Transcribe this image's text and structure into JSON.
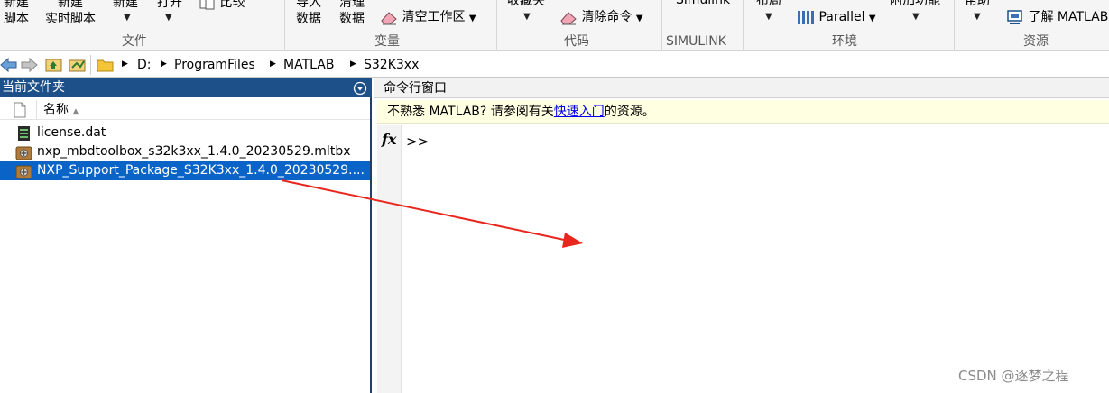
{
  "ribbon": {
    "file_group": {
      "label": "文件",
      "new_script": [
        "新建",
        "脚本"
      ],
      "new_live_script": [
        "新建",
        "实时脚本"
      ],
      "new": "新建",
      "open": "打开",
      "compare": "比较"
    },
    "variable_group": {
      "label": "变量",
      "import_data": [
        "导入",
        "数据"
      ],
      "clean_data": [
        "清理",
        "数据"
      ],
      "clear_workspace": "清空工作区"
    },
    "code_group": {
      "label": "代码",
      "favorites": "收藏夹",
      "clear_commands": "清除命令"
    },
    "simulink_group": {
      "label": "SIMULINK",
      "simulink": "Simulink"
    },
    "environment_group": {
      "label": "环境",
      "layout": "布局",
      "parallel": "Parallel",
      "addons": "附加功能"
    },
    "resources_group": {
      "label": "资源",
      "help": "帮助",
      "learn_matlab": "了解 MATLAB"
    }
  },
  "address_bar": {
    "path": [
      "D:",
      "ProgramFiles",
      "MATLAB",
      "S32K3xx"
    ]
  },
  "folder_pane": {
    "title": "当前文件夹",
    "column_name": "名称",
    "files": [
      {
        "name": "license.dat",
        "icon": "dat-file-icon",
        "selected": false
      },
      {
        "name": "nxp_mbdtoolbox_s32k3xx_1.4.0_20230529.mltbx",
        "icon": "toolbox-file-icon",
        "selected": false
      },
      {
        "name": "NXP_Support_Package_S32K3xx_1.4.0_20230529....",
        "icon": "toolbox-file-icon",
        "selected": true
      }
    ]
  },
  "command_window": {
    "title": "命令行窗口",
    "notice_prefix": "不熟悉 MATLAB? 请参阅有关",
    "notice_link": "快速入门",
    "notice_suffix": "的资源。",
    "fx_label": "fx",
    "prompt": ">>"
  },
  "watermark": "CSDN @逐梦之程",
  "colors": {
    "titlebar_blue": "#1d4f88",
    "selected_row": "#0a64c8",
    "notice_bg": "#ffffe1",
    "annotation_red": "#e8261d"
  }
}
